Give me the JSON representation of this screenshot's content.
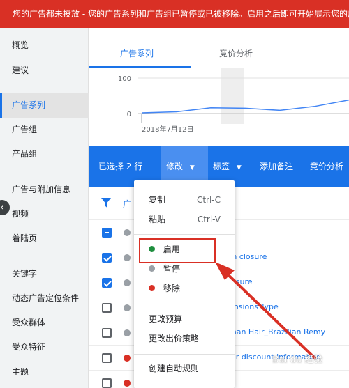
{
  "banner": {
    "text": "您的广告都未投放 - 您的广告系列和广告组已暂停或已被移除。启用之后即可开始展示您的广告"
  },
  "sidebar": {
    "items": [
      {
        "label": "概览"
      },
      {
        "label": "建议"
      },
      {
        "label": "广告系列"
      },
      {
        "label": "广告组"
      },
      {
        "label": "产品组"
      },
      {
        "label": "广告与附加信息"
      },
      {
        "label": "视频"
      },
      {
        "label": "着陆页"
      },
      {
        "label": "关键字"
      },
      {
        "label": "动态广告定位条件"
      },
      {
        "label": "受众群体"
      },
      {
        "label": "受众特征"
      },
      {
        "label": "主题"
      }
    ],
    "active_index": 2
  },
  "tabs": [
    {
      "label": "广告系列"
    },
    {
      "label": "竞价分析"
    }
  ],
  "chart_data": {
    "type": "line",
    "y_ticks": [
      "100",
      "0"
    ],
    "x_ticks": [
      "2018年7月12日"
    ],
    "series": [
      {
        "values": [
          2,
          5,
          16,
          15,
          9,
          20,
          38
        ]
      }
    ],
    "ylim": [
      0,
      100
    ],
    "color": "#4285f4"
  },
  "toolbar": {
    "selected_text": "已选择 2 行",
    "modify_label": "修改",
    "labels_label": "标签",
    "add_note_label": "添加备注",
    "bid_analysis_label": "竞价分析"
  },
  "table": {
    "header_filter_text": "广",
    "rows": [
      {
        "checked": true,
        "status": "paused",
        "text": "th closure"
      },
      {
        "checked": true,
        "status": "paused",
        "text": "losure"
      },
      {
        "checked": false,
        "status": "paused",
        "text": "ensions Type"
      },
      {
        "checked": false,
        "status": "paused",
        "text": "man Hair_Brazilian Remy"
      },
      {
        "checked": false,
        "status": "removed",
        "text": "air discount information"
      },
      {
        "checked": false,
        "status": "removed",
        "text": ""
      }
    ]
  },
  "menu": {
    "copy": {
      "label": "复制",
      "shortcut": "Ctrl-C"
    },
    "paste": {
      "label": "粘贴",
      "shortcut": "Ctrl-V"
    },
    "enable": {
      "label": "启用"
    },
    "pause": {
      "label": "暂停"
    },
    "remove": {
      "label": "移除"
    },
    "change_budget": {
      "label": "更改预算"
    },
    "change_bid_strategy": {
      "label": "更改出价策略"
    },
    "create_rule": {
      "label": "创建自动规则"
    }
  },
  "colors": {
    "brand_blue": "#1a73e8",
    "banner_red": "#d93025",
    "enable_green": "#1e8e3e",
    "highlight_red": "#d93025"
  },
  "watermark": {
    "text": "Bai du 经验"
  }
}
